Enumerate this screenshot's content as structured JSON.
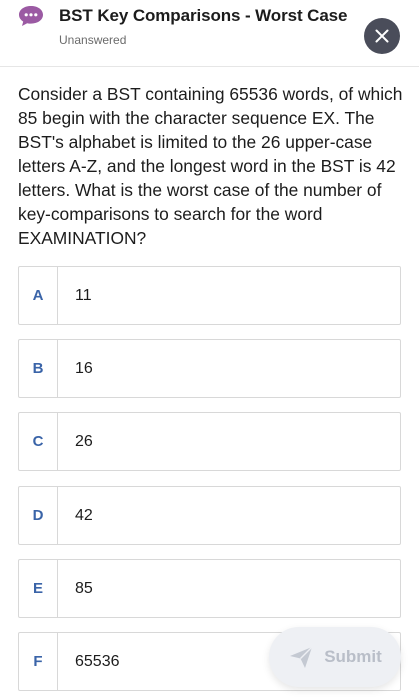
{
  "header": {
    "title": "BST Key Comparisons - Worst Case",
    "status": "Unanswered",
    "chat_icon": "chat-bubble-icon",
    "close_icon": "close-icon"
  },
  "question": {
    "text": "Consider a BST containing 65536 words, of which 85 begin with the character sequence EX. The BST's alphabet is limited to the 26 upper-case letters A-Z, and the longest word in the BST is 42 letters. What is the worst case of the number of key-comparisons to search for the word EXAMINATION?"
  },
  "options": [
    {
      "letter": "A",
      "text": "11"
    },
    {
      "letter": "B",
      "text": "16"
    },
    {
      "letter": "C",
      "text": "26"
    },
    {
      "letter": "D",
      "text": "42"
    },
    {
      "letter": "E",
      "text": "85"
    },
    {
      "letter": "F",
      "text": "65536"
    }
  ],
  "submit": {
    "label": "Submit",
    "icon": "send-icon"
  },
  "colors": {
    "accent": "#3a64a8",
    "chat_icon": "#9b5aa3",
    "close_bg": "#4a4d5a",
    "submit_bg": "#eef0f4",
    "submit_text": "#b9bec8"
  }
}
